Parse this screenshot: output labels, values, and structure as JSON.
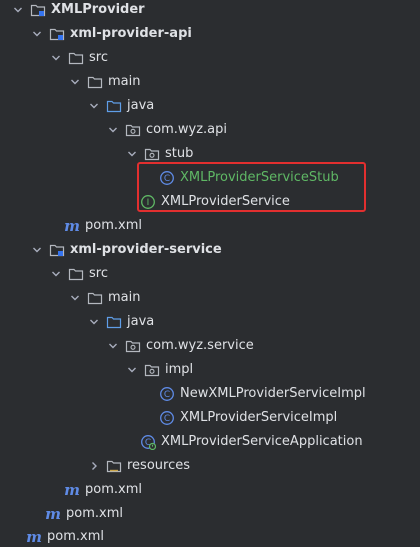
{
  "tree": {
    "root": "XMLProvider",
    "module_api": "xml-provider-api",
    "api_src": "src",
    "api_main": "main",
    "api_java": "java",
    "api_package": "com.wyz.api",
    "api_stub": "stub",
    "api_stub_class": "XMLProviderServiceStub",
    "api_interface": "XMLProviderService",
    "api_pom": "pom.xml",
    "module_service": "xml-provider-service",
    "svc_src": "src",
    "svc_main": "main",
    "svc_java": "java",
    "svc_package": "com.wyz.service",
    "svc_impl": "impl",
    "svc_new_impl": "NewXMLProviderServiceImpl",
    "svc_impl_class": "XMLProviderServiceImpl",
    "svc_app": "XMLProviderServiceApplication",
    "svc_resources": "resources",
    "svc_pom": "pom.xml",
    "root_pom_inner": "pom.xml",
    "root_pom": "pom.xml"
  },
  "icons": {
    "module": "module-folder-icon",
    "folder": "folder-icon",
    "source_root": "source-root-folder-icon",
    "package": "package-icon",
    "class": "class-icon",
    "interface": "interface-icon",
    "maven": "maven-pom-icon",
    "spring_app": "spring-boot-class-icon"
  },
  "colors": {
    "background": "#2b2d30",
    "text": "#dfe1e5",
    "folder": "#b4b8bf",
    "source_folder": "#5f9ee8",
    "class": "#5f8be6",
    "interface": "#5fb865",
    "highlight": "#e22f2f"
  }
}
